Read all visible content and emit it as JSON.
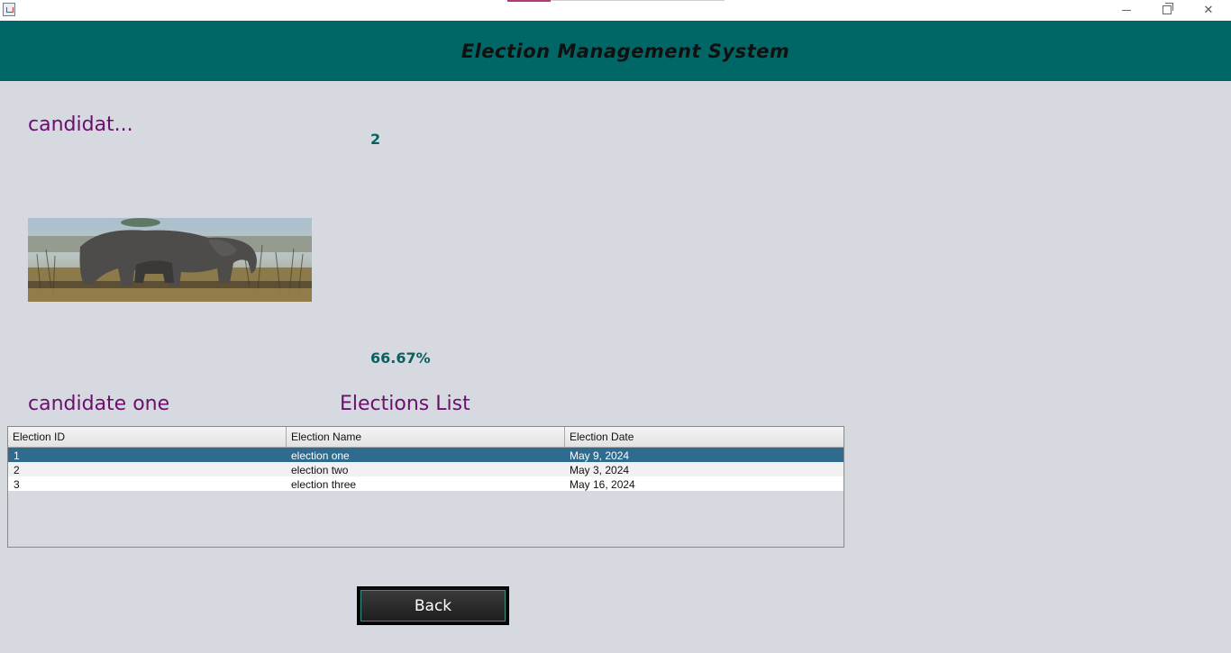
{
  "window": {
    "minimize_icon": "minimize-icon",
    "restore_icon": "restore-icon",
    "close_icon": "close-icon"
  },
  "header": {
    "title": "Election Management System",
    "background": "#006666"
  },
  "candidate": {
    "name_truncated": "candidat...",
    "votes": "2",
    "photo": "elephant-photo",
    "percentage": "66.67%",
    "name": "candidate one"
  },
  "elections": {
    "title": "Elections List",
    "columns": [
      "Election ID",
      "Election Name",
      "Election Date"
    ],
    "rows": [
      {
        "id": "1",
        "name": "election one",
        "date": "May 9, 2024",
        "selected": true
      },
      {
        "id": "2",
        "name": "election two",
        "date": "May 3, 2024",
        "selected": false
      },
      {
        "id": "3",
        "name": "election three",
        "date": "May 16, 2024",
        "selected": false
      }
    ]
  },
  "actions": {
    "back_label": "Back"
  },
  "colors": {
    "accent_text": "#6b0f6e",
    "value_text": "#0b5f5f",
    "selection": "#2f6b8f",
    "background": "#d6d9e0"
  }
}
